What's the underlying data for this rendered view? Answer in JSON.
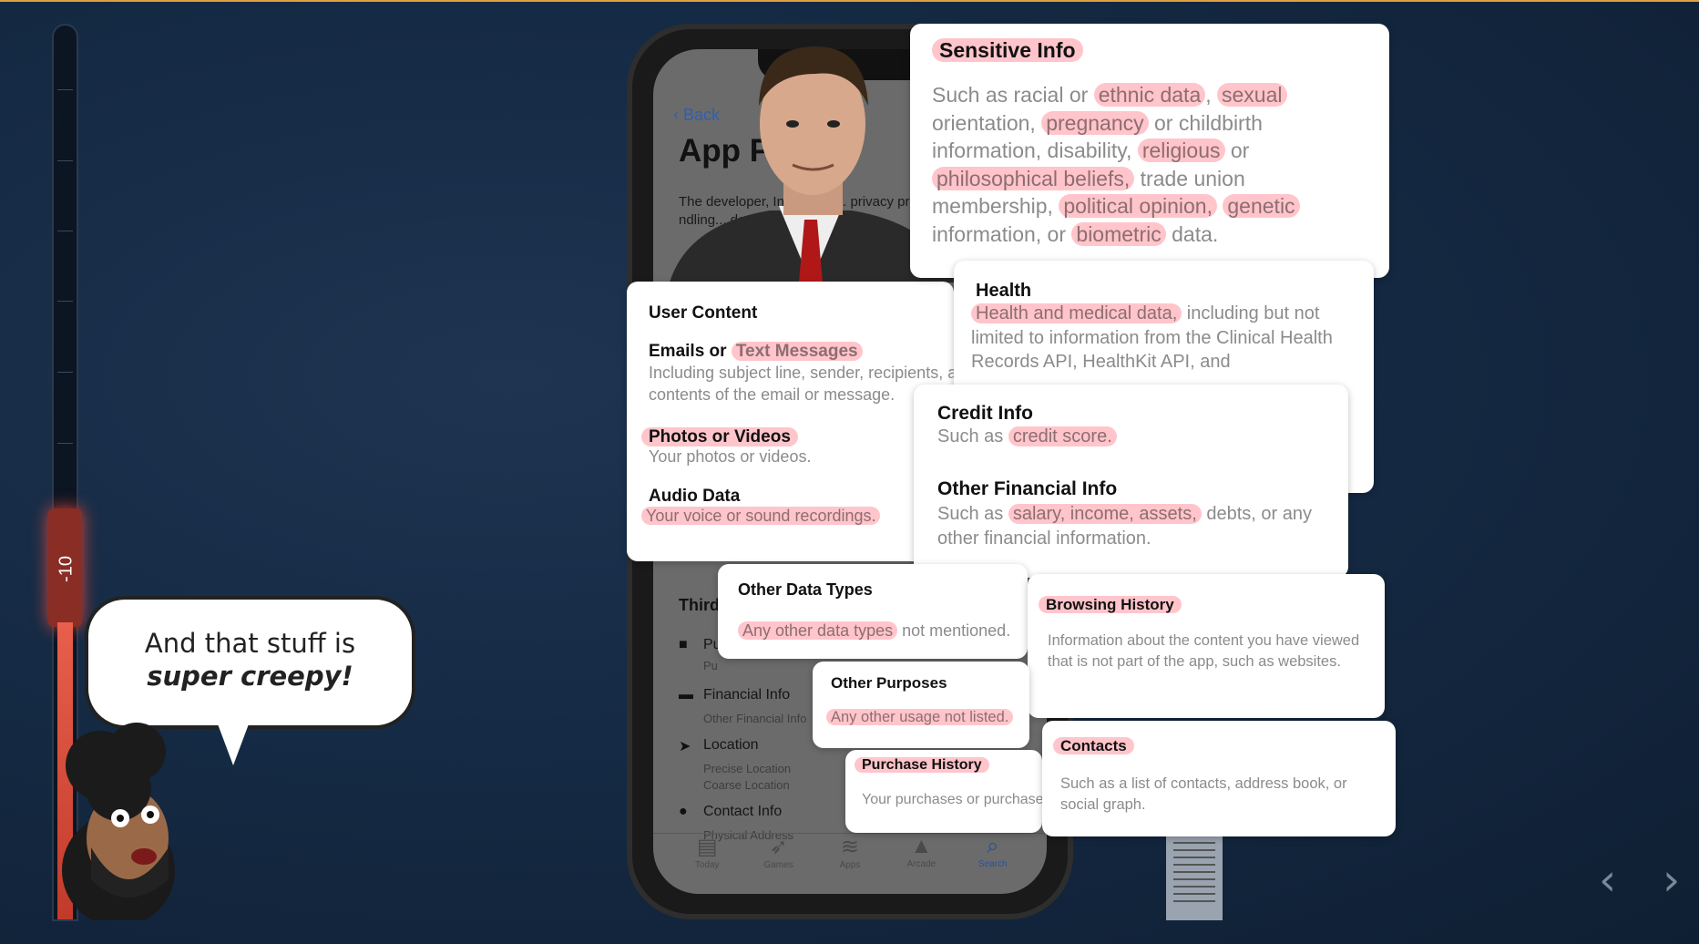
{
  "meter": {
    "label": "-10",
    "level_percent": 45
  },
  "bubble": {
    "line1": "And that stuff is",
    "line2": "super creepy!"
  },
  "phone": {
    "back": "Back",
    "title": "App Pri",
    "desc": "The developer, In... indica... privacy practic... ndling... describ...",
    "third": "Third-",
    "items": [
      {
        "icon": "bag-icon",
        "label": "Pu",
        "sub": "Pu"
      },
      {
        "icon": "credit-card-icon",
        "label": "Financial Info",
        "sub": "Other Financial Info"
      },
      {
        "icon": "location-arrow-icon",
        "label": "Location",
        "sub": "Precise Location\nCoarse Location"
      },
      {
        "icon": "info-icon",
        "label": "Contact Info",
        "sub": "Physical Address"
      }
    ],
    "tabs": [
      {
        "label": "Today",
        "icon": "today-icon"
      },
      {
        "label": "Games",
        "icon": "rocket-icon"
      },
      {
        "label": "Apps",
        "icon": "layers-icon"
      },
      {
        "label": "Arcade",
        "icon": "joystick-icon"
      },
      {
        "label": "Search",
        "icon": "search-icon",
        "active": true
      }
    ]
  },
  "cards": {
    "sensitive": {
      "title": "Sensitive Info",
      "body": [
        [
          "Such as racial or ",
          0
        ],
        [
          "ethnic data",
          1
        ],
        [
          ", ",
          0
        ],
        [
          "sexual",
          1
        ],
        [
          " orientation, ",
          0
        ],
        [
          "pregnancy",
          1
        ],
        [
          " or childbirth information, disability, ",
          0
        ],
        [
          "religious",
          1
        ],
        [
          " or ",
          0
        ],
        [
          "philosophical beliefs,",
          1
        ],
        [
          " trade union membership, ",
          0
        ],
        [
          "political opinion,",
          1
        ],
        [
          " ",
          0
        ],
        [
          "genetic",
          1
        ],
        [
          " information, or ",
          0
        ],
        [
          "biometric",
          1
        ],
        [
          " data.",
          0
        ]
      ]
    },
    "health": {
      "title": "Health",
      "body": [
        [
          "Health and medical data,",
          1
        ],
        [
          " including but not limited to information from the Clinical Health Records API, HealthKit API, and",
          0
        ]
      ]
    },
    "credit": {
      "title": "Credit Info",
      "body": [
        [
          "Such as ",
          0
        ],
        [
          "credit score.",
          1
        ]
      ]
    },
    "financial": {
      "title": "Other Financial Info",
      "body": [
        [
          "Such as ",
          0
        ],
        [
          "salary, income, assets,",
          1
        ],
        [
          " debts, or any other financial information.",
          0
        ]
      ]
    },
    "user_content": {
      "title": "User Content",
      "emails_title": [
        [
          "Emails or ",
          0
        ],
        [
          "Text Messages",
          1
        ]
      ],
      "emails_body": "Including subject line, sender, recipients, and contents of the email or message.",
      "photos_title": "Photos or Videos",
      "photos_body": "Your photos or videos.",
      "audio_title": "Audio Data",
      "audio_body": [
        [
          "Your voice or sound recordings.",
          1
        ]
      ]
    },
    "other_data": {
      "title": "Other Data Types",
      "body": [
        [
          "Any other data types",
          1
        ],
        [
          " not mentioned.",
          0
        ]
      ]
    },
    "other_purposes": {
      "title": "Other Purposes",
      "body": [
        [
          "Any other usage not listed.",
          1
        ]
      ]
    },
    "purchase": {
      "title": "Purchase History",
      "body": "Your purchases or purchase"
    },
    "browsing": {
      "title": "Browsing History",
      "body": "Information about the content you have viewed that is not part of the app, such as websites."
    },
    "contacts": {
      "title": "Contacts",
      "body": "Such as a list of contacts, address book, or social graph."
    }
  },
  "nav": {
    "prev": "‹",
    "next": "›"
  },
  "colors": {
    "highlight": "#ffa0aa",
    "background": "#13243a",
    "meter_fill": "#e8604c",
    "link": "#2f5fb0"
  }
}
